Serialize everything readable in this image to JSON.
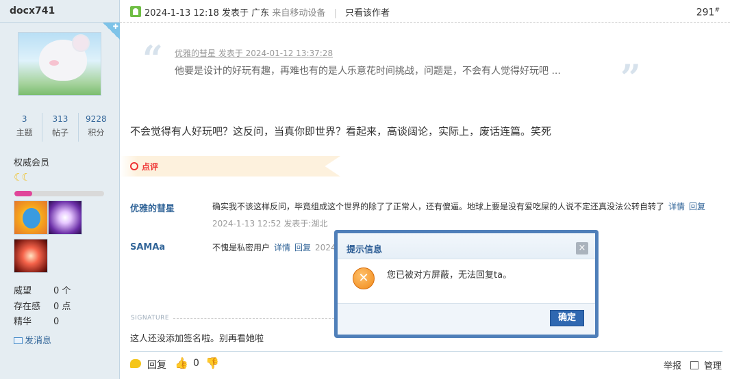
{
  "user": {
    "username": "docx741",
    "stats": [
      {
        "value": "3",
        "label": "主题"
      },
      {
        "value": "313",
        "label": "帖子"
      },
      {
        "value": "9228",
        "label": "积分"
      }
    ],
    "group": "权威会员",
    "level_progress": 0.2,
    "info": [
      {
        "key": "威望",
        "value": "0 个"
      },
      {
        "key": "存在感",
        "value": "0 点"
      },
      {
        "key": "精华",
        "value": "0"
      }
    ],
    "send_message": "发消息"
  },
  "post": {
    "meta_date": "2024-1-13 12:18",
    "meta_posted": "发表于",
    "meta_location": "广东",
    "meta_device": "来自移动设备",
    "only_author": "只看该作者",
    "floor": "291",
    "floor_mark": "#",
    "quote": {
      "author_line": "优雅的彗星 发表于 2024-01-12 13:37:28",
      "text": "他要是设计的好玩有趣，再难也有的是人乐意花时间挑战，问题是，不会有人觉得好玩吧 ..."
    },
    "body": "不会觉得有人好玩吧？这反问，当真你即世界？看起来，高谈阔论，实际上，废话连篇。笑死"
  },
  "comments": {
    "label": "点评",
    "items": [
      {
        "author": "优雅的彗星",
        "text": "确实我不该这样反问，毕竟组成这个世界的除了了正常人，还有傻逼。地球上要是没有爱吃屎的人说不定还真没法公转自转了",
        "detail": "详情",
        "reply": "回复",
        "time": "2024-1-13 12:52 发表于:湖北"
      },
      {
        "author": "SAMAa",
        "text": "不愧是私密用户",
        "detail": "详情",
        "reply": "回复",
        "time": "2024-"
      }
    ]
  },
  "signature": {
    "label": "SIGNATURE",
    "text": "这人还没添加签名啦。别再看她啦"
  },
  "footer": {
    "reply": "回复",
    "like_count": "0",
    "report": "举报",
    "manage": "管理"
  },
  "dialog": {
    "title": "提示信息",
    "close": "×",
    "message": "您已被对方屏蔽，无法回复ta。",
    "ok": "确定"
  }
}
